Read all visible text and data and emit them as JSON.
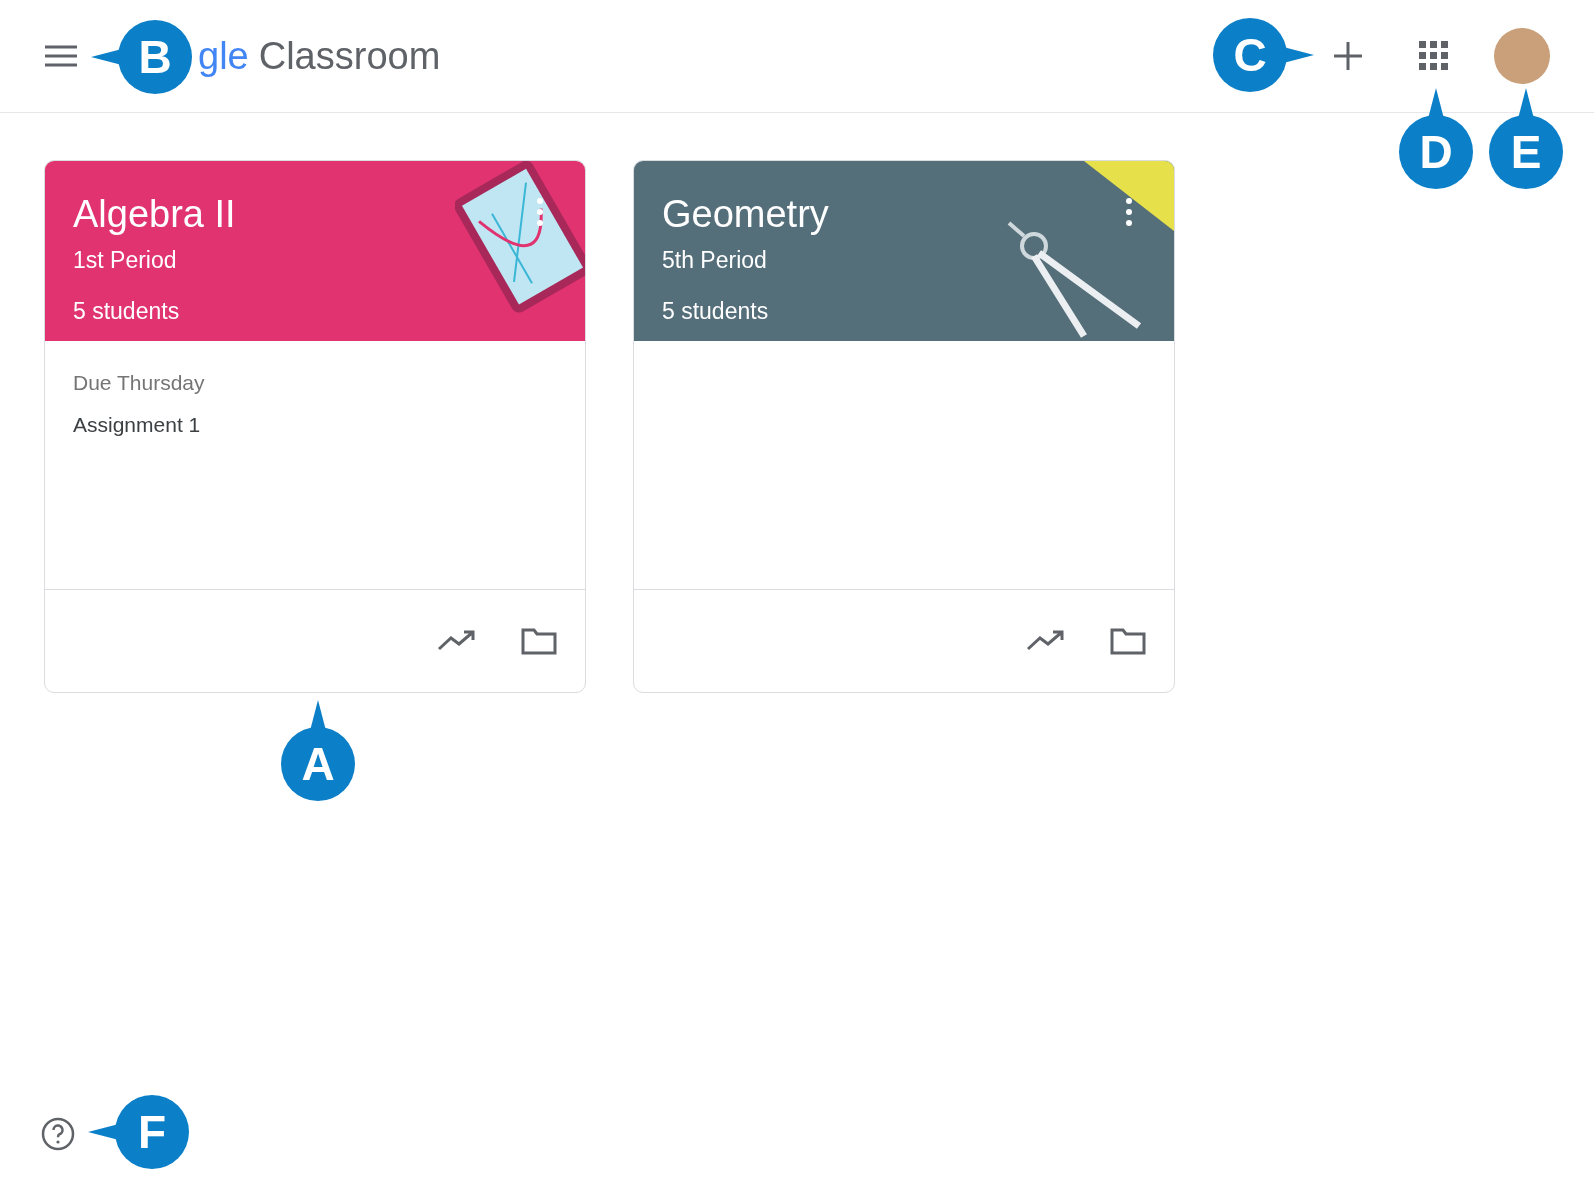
{
  "header": {
    "logo_visible": "gle",
    "app_name": "Classroom"
  },
  "classes": [
    {
      "title": "Algebra II",
      "period": "1st Period",
      "students": "5 students",
      "color": "#e03370",
      "kind": "tablet",
      "due_label": "Due Thursday",
      "assignment": "Assignment 1"
    },
    {
      "title": "Geometry",
      "period": "5th Period",
      "students": "5 students",
      "color": "#546e7a",
      "kind": "compass"
    }
  ],
  "callouts": [
    {
      "letter": "B",
      "kind": "left"
    },
    {
      "letter": "C",
      "kind": "right"
    },
    {
      "letter": "D",
      "kind": "up"
    },
    {
      "letter": "E",
      "kind": "up"
    },
    {
      "letter": "A",
      "kind": "up"
    },
    {
      "letter": "F",
      "kind": "left"
    }
  ]
}
